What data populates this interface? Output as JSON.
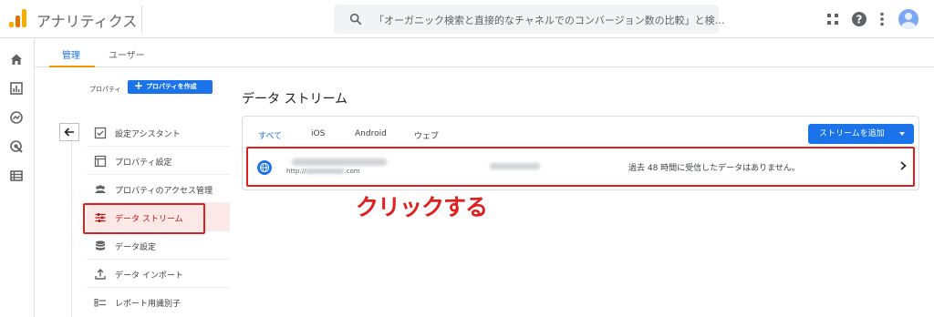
{
  "app": {
    "title": "アナリティクス"
  },
  "search": {
    "placeholder": "「オーガニック検索と直接的なチャネルでのコンバージョン数の比較」と検…"
  },
  "topbar": {
    "icons": [
      "apps-icon",
      "help-icon",
      "more-vert-icon",
      "account-avatar"
    ]
  },
  "rail": {
    "icons": [
      "home-icon",
      "reports-icon",
      "explore-icon",
      "advertising-icon",
      "configure-icon"
    ]
  },
  "admin_tabs": [
    {
      "label": "管理",
      "active": true
    },
    {
      "label": "ユーザー",
      "active": false
    }
  ],
  "property": {
    "label": "プロパティ",
    "create_button": "プロパティを作成",
    "nav_items": [
      {
        "label": "設定アシスタント",
        "icon": "checklist-icon"
      },
      {
        "label": "プロパティ設定",
        "icon": "property-icon"
      },
      {
        "label": "プロパティのアクセス管理",
        "icon": "people-icon"
      },
      {
        "label": "データ ストリーム",
        "icon": "streams-icon",
        "selected": true
      },
      {
        "label": "データ設定",
        "icon": "database-icon"
      },
      {
        "label": "データ インポート",
        "icon": "upload-icon"
      },
      {
        "label": "レポート用識別子",
        "icon": "identifier-icon"
      }
    ]
  },
  "main": {
    "title": "データ ストリーム",
    "tabs": [
      {
        "label": "すべて",
        "active": true
      },
      {
        "label": "iOS"
      },
      {
        "label": "Android"
      },
      {
        "label": "ウェブ"
      }
    ],
    "add_button": "ストリームを追加",
    "stream": {
      "url_prefix": "http://",
      "url_suffix": ".com",
      "status": "過去 48 時間に受信したデータはありません。"
    }
  },
  "annotation": {
    "callout": "クリックする",
    "color": "#e0201f"
  },
  "colors": {
    "accent": "#1a73e8",
    "brand": "#f9ab00",
    "selected_bg": "#fce8e6"
  }
}
